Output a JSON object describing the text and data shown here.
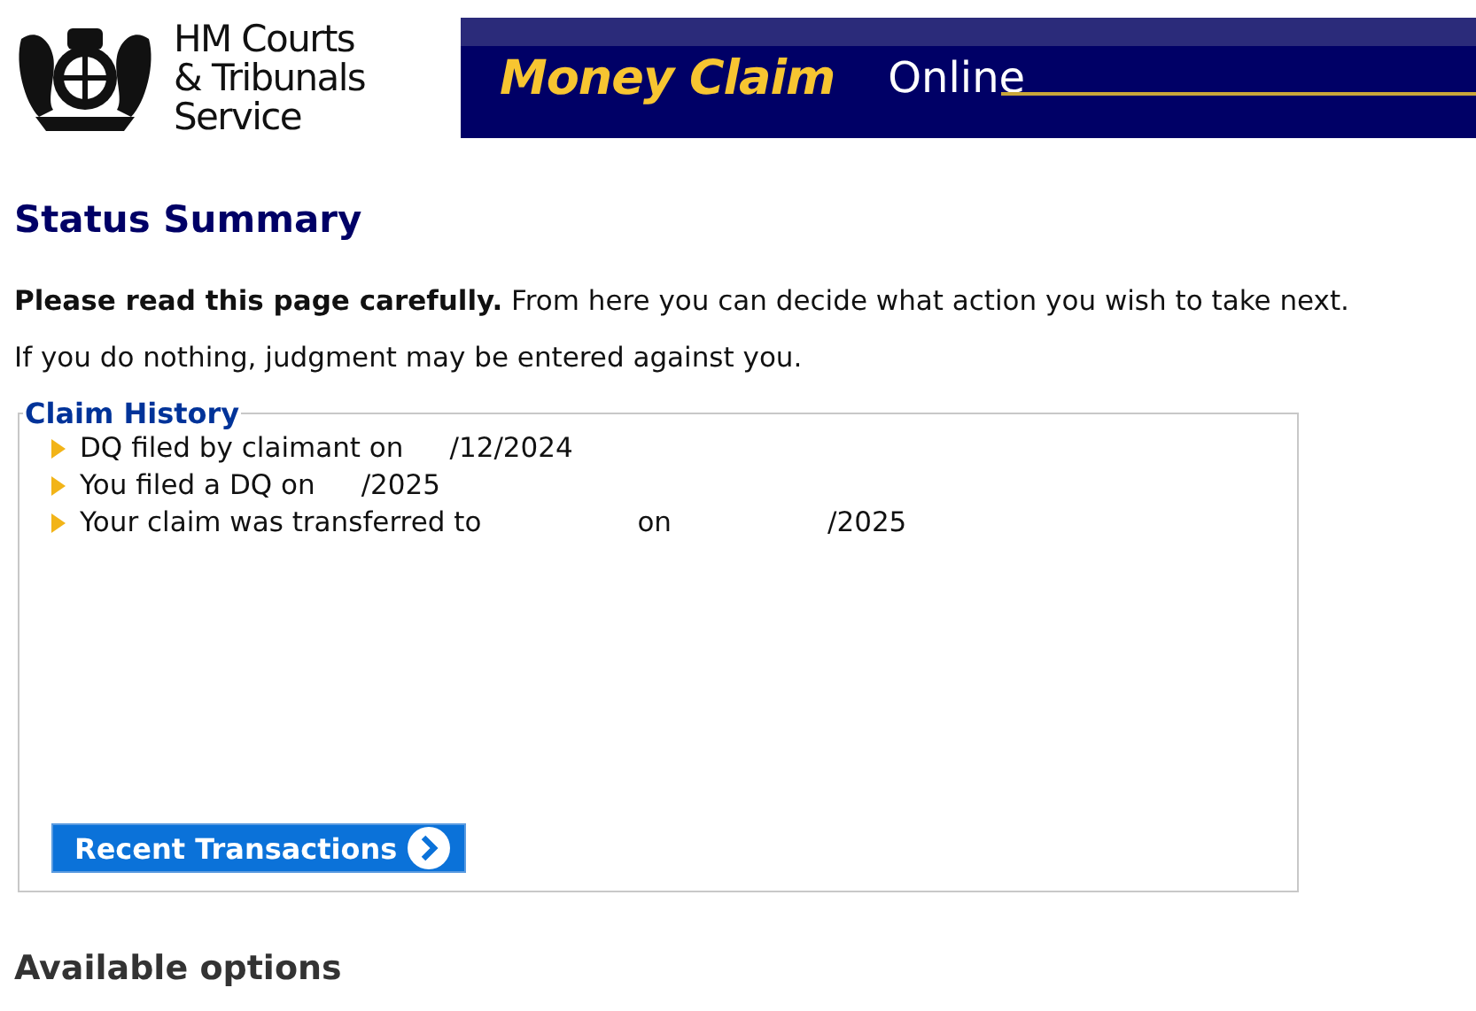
{
  "header": {
    "organisation": [
      "HM Courts",
      "& Tribunals",
      "Service"
    ],
    "banner_title": "Money Claim",
    "banner_subtitle": "Online"
  },
  "title": "Status Summary",
  "intro": "**Please read this page carefully.** From here you can decide what action you wish to take next.",
  "warning": "If you do nothing, judgment may be entered against you.",
  "claim_history": {
    "legend": "Claim History",
    "items": [
      {
        "parts": [
          "DQ filed by claimant on",
          "/12/2024"
        ]
      },
      {
        "parts": [
          "You filed a DQ on",
          "/2025"
        ]
      },
      {
        "parts": [
          "Your claim was transferred to",
          "on",
          "/2025"
        ]
      }
    ],
    "button": "Recent Transactions"
  },
  "next_section": "Available options"
}
